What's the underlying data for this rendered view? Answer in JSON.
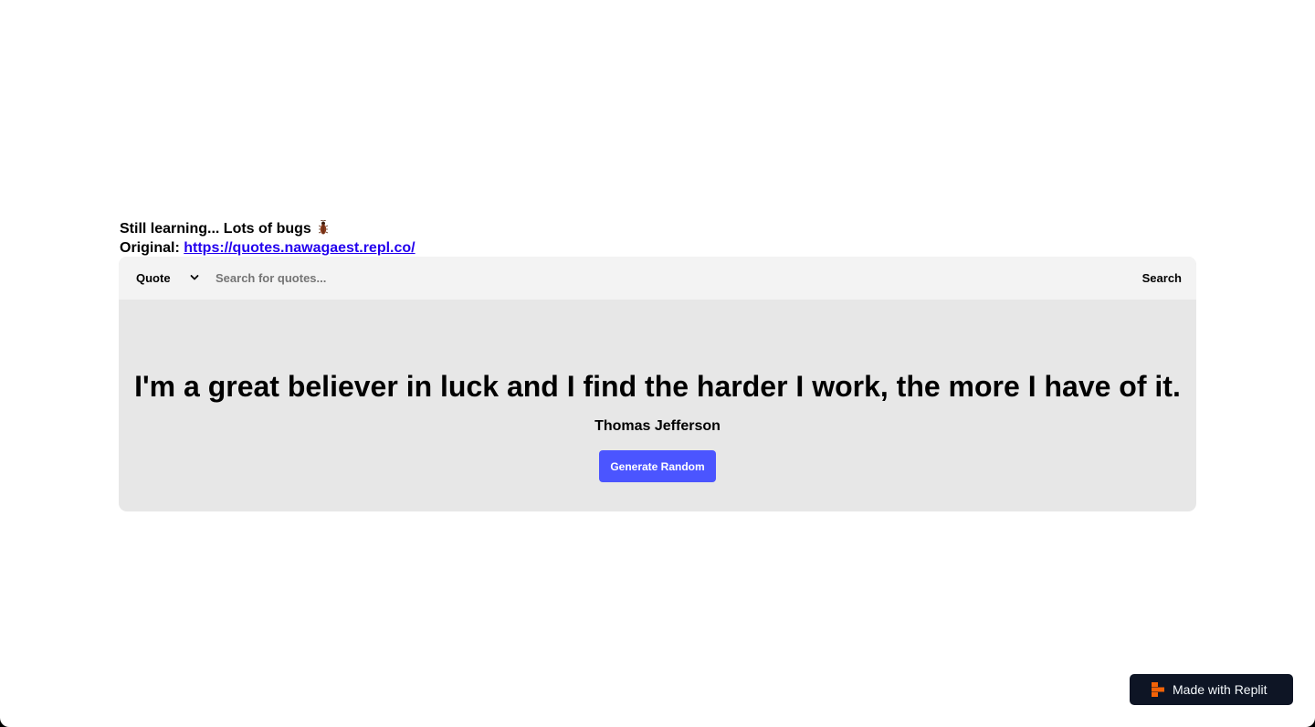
{
  "intro": {
    "line1": "Still learning... Lots of bugs",
    "bug_icon": "cockroach-emoji",
    "original_label": "Original:",
    "original_link": "https://quotes.nawagaest.repl.co/"
  },
  "search": {
    "select_value": "Quote",
    "placeholder": "Search for quotes...",
    "button_label": "Search"
  },
  "quote": {
    "text": "I'm a great believer in luck and I find the harder I work, the more I have of it.",
    "author": "Thomas Jefferson",
    "generate_label": "Generate Random"
  },
  "badge": {
    "label": "Made with Replit",
    "icon": "replit-logo-icon"
  },
  "colors": {
    "accent": "#4b55ff",
    "link": "#2300ee",
    "badge_bg": "#0e1525",
    "replit_orange": "#f26207"
  }
}
